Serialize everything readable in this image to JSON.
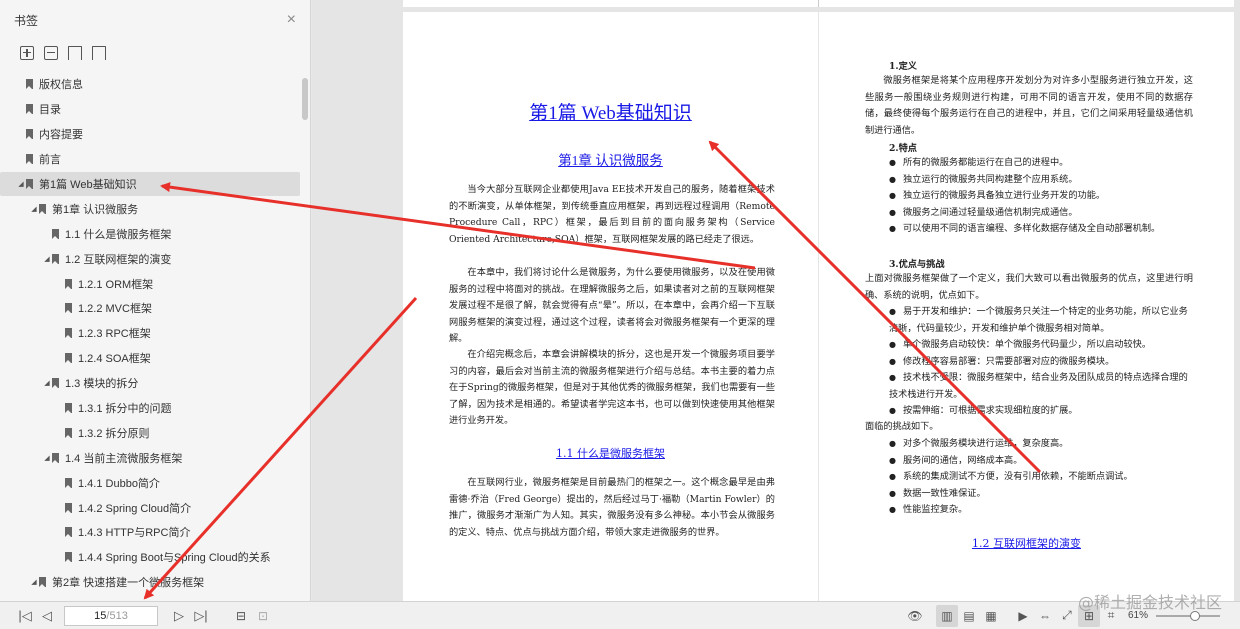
{
  "sidebar": {
    "title": "书签",
    "close_glyph": "×",
    "items": [
      {
        "label": "版权信息",
        "indent": 0,
        "toggle": ""
      },
      {
        "label": "目录",
        "indent": 0,
        "toggle": ""
      },
      {
        "label": "内容提要",
        "indent": 0,
        "toggle": ""
      },
      {
        "label": "前言",
        "indent": 0,
        "toggle": ""
      },
      {
        "label": "第1篇 Web基础知识",
        "indent": 0,
        "toggle": "◢",
        "selected": true
      },
      {
        "label": "第1章 认识微服务",
        "indent": 1,
        "toggle": "◢"
      },
      {
        "label": "1.1 什么是微服务框架",
        "indent": 2,
        "toggle": ""
      },
      {
        "label": "1.2 互联网框架的演变",
        "indent": 2,
        "toggle": "◢"
      },
      {
        "label": "1.2.1 ORM框架",
        "indent": 3,
        "toggle": ""
      },
      {
        "label": "1.2.2 MVC框架",
        "indent": 3,
        "toggle": ""
      },
      {
        "label": "1.2.3 RPC框架",
        "indent": 3,
        "toggle": ""
      },
      {
        "label": "1.2.4 SOA框架",
        "indent": 3,
        "toggle": ""
      },
      {
        "label": "1.3 模块的拆分",
        "indent": 2,
        "toggle": "◢"
      },
      {
        "label": "1.3.1 拆分中的问题",
        "indent": 3,
        "toggle": ""
      },
      {
        "label": "1.3.2 拆分原则",
        "indent": 3,
        "toggle": ""
      },
      {
        "label": "1.4 当前主流微服务框架",
        "indent": 2,
        "toggle": "◢"
      },
      {
        "label": "1.4.1 Dubbo简介",
        "indent": 3,
        "toggle": ""
      },
      {
        "label": "1.4.2 Spring Cloud简介",
        "indent": 3,
        "toggle": ""
      },
      {
        "label": "1.4.3 HTTP与RPC简介",
        "indent": 3,
        "toggle": ""
      },
      {
        "label": "1.4.4 Spring Boot与Spring Cloud的关系",
        "indent": 3,
        "toggle": ""
      },
      {
        "label": "第2章 快速搭建一个微服务框架",
        "indent": 1,
        "toggle": "◢"
      }
    ]
  },
  "left_page": {
    "part_title": "第1篇 Web基础知识",
    "chapter_title": "第1章 认识微服务",
    "paragraphs": [
      "当今大部分互联网企业都使用Java EE技术开发自己的服务，随着框架技术的不断演变，从单体框架，到传统垂直应用框架，再到远程过程调用（Remote Procedure Call，RPC）框架，最后到目前的面向服务架构（Service Oriented Architecture,SOA）框架，互联网框架发展的路已经走了很远。",
      "在本章中，我们将讨论什么是微服务，为什么要使用微服务，以及在使用微服务的过程中将面对的挑战。在理解微服务之后，如果读者对之前的互联网框架发展过程不是很了解，就会觉得有点“晕”。所以，在本章中，会再介绍一下互联网服务框架的演变过程，通过这个过程，读者将会对微服务框架有一个更深的理解。",
      "在介绍完概念后，本章会讲解模块的拆分，这也是开发一个微服务项目要学习的内容，最后会对当前主流的微服务框架进行介绍与总结。本书主要的着力点在于Spring的微服务框架，但是对于其他优秀的微服务框架，我们也需要有一些了解，因为技术是相通的。希望读者学完这本书，也可以做到快速使用其他框架进行业务开发。"
    ],
    "section_title": "1.1 什么是微服务框架",
    "section_paragraph": "在互联网行业，微服务框架是目前最热门的框架之一。这个概念最早是由弗雷德·乔治（Fred George）提出的，然后经过马丁·福勒（Martin Fowler）的推广，微服务才渐渐广为人知。其实，微服务没有多么神秘。本小节会从微服务的定义、特点、优点与挑战方面介绍，带领大家走进微服务的世界。"
  },
  "right_page": {
    "h1": "1.定义",
    "p1": "微服务框架是将某个应用程序开发划分为对许多小型服务进行独立开发，这些服务一般围绕业务规则进行构建，可用不同的语言开发，使用不同的数据存储，最终使得每个服务运行在自己的进程中，并且，它们之间采用轻量级通信机制进行通信。",
    "h2": "2.特点",
    "features": [
      "所有的微服务都能运行在自己的进程中。",
      "独立运行的微服务共同构建整个应用系统。",
      "独立运行的微服务具备独立进行业务开发的功能。",
      "微服务之间通过轻量级通信机制完成通信。",
      "可以使用不同的语言编程、多样化数据存储及全自动部署机制。"
    ],
    "h3": "3.优点与挑战",
    "p3": "上面对微服务框架做了一个定义，我们大致可以看出微服务的优点，这里进行明确、系统的说明，优点如下。",
    "advantages": [
      "易于开发和维护：一个微服务只关注一个特定的业务功能，所以它业务清晰，代码量较少，开发和维护单个微服务相对简单。",
      "单个微服务启动较快：单个微服务代码量少，所以启动较快。",
      "修改程序容易部署：只需要部署对应的微服务模块。",
      "技术栈不受限：微服务框架中，结合业务及团队成员的特点选择合理的技术栈进行开发。",
      "按需伸缩：可根据需求实现细粒度的扩展。"
    ],
    "challenges_intro": "面临的挑战如下。",
    "challenges": [
      "对多个微服务模块进行运维，复杂度高。",
      "服务间的通信，网络成本高。",
      "系统的集成测试不方便，没有引用依赖，不能断点调试。",
      "数据一致性难保证。",
      "性能监控复杂。"
    ],
    "next_section": "1.2 互联网框架的演变"
  },
  "toolbar": {
    "first_glyph": "|◁",
    "prev_glyph": "◁",
    "next_glyph": "▷",
    "last_glyph": "▷|",
    "current_page": "15",
    "total_pages": "/513",
    "zoom": "61%",
    "zoom_level": 0.61
  },
  "watermark": "@稀土掘金技术社区",
  "annotation_color": "#e8302a"
}
